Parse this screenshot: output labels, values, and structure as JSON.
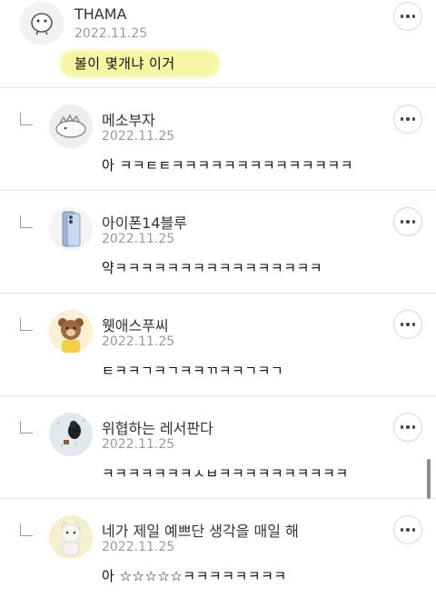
{
  "comments": [
    {
      "name": "THAMA",
      "date": "2022.11.25",
      "text": "볼이 몇개냐 이거",
      "avatar_icon": "mascot-icon",
      "is_reply": false
    },
    {
      "name": "메소부자",
      "date": "2022.11.25",
      "text": "아 ㅋㅋㅌㅌㅋㅋㅋㅋㅋㅋㅋㅋㅋㅋㅋㅋㅋㅋ",
      "avatar_icon": "dinosaur-icon",
      "is_reply": true
    },
    {
      "name": "아이폰14블루",
      "date": "2022.11.25",
      "text": "약ㅋㅋㅋㅋㅋㅋㅋㅋㅋㅋㅋㅋㅋㅋㅋㅋ",
      "avatar_icon": "phone-icon",
      "is_reply": true
    },
    {
      "name": "웻애스푸씨",
      "date": "2022.11.25",
      "text": "ㅌㅋㅋㄱㅋㄱㅋㅋㄲㅋㅋㄱㅋㄱ",
      "avatar_icon": "bear-icon",
      "is_reply": true
    },
    {
      "name": "위협하는 레서판다",
      "date": "2022.11.25",
      "text": "ㅋㅋㅋㅋㅋㅋㅋㅅㅂㅋㅋㅋㅋㅋㅋㅋㅋㅋㅋ",
      "avatar_icon": "snow-photo-icon",
      "is_reply": true
    },
    {
      "name": "네가 제일 예쁘단 생각을 매일 해",
      "date": "2022.11.25",
      "text": "아 ☆☆☆☆☆ㅋㅋㅋㅋㅋㅋㅋㅋ",
      "avatar_icon": "cat-icon",
      "is_reply": true
    }
  ],
  "colors": {
    "highlight": "#f4f59a",
    "date": "#9a9a9a",
    "divider": "#e6e6e6"
  }
}
